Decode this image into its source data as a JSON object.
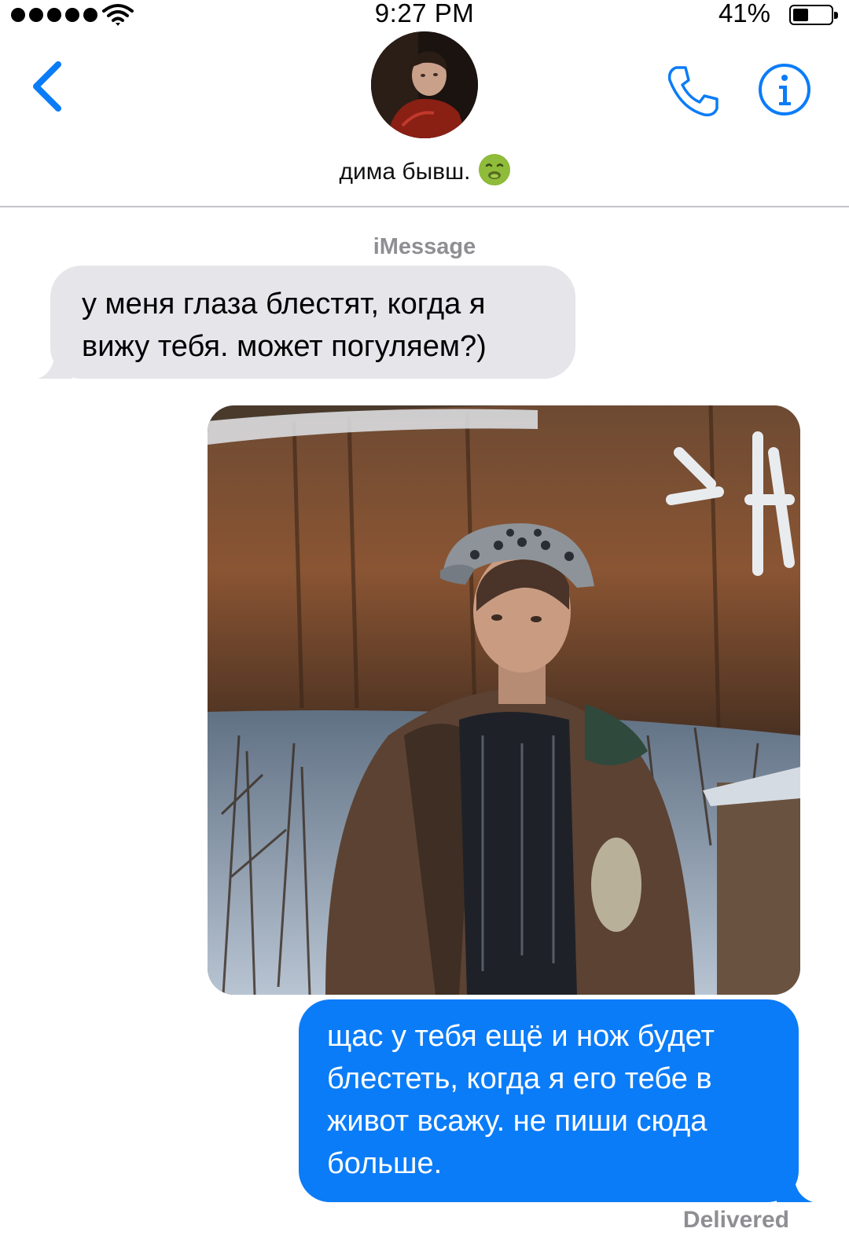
{
  "status_bar": {
    "time": "9:27 PM",
    "battery_percent": "41%",
    "battery_level": 0.41,
    "signal_bars": 5,
    "icons": [
      "signal-dots-icon",
      "wifi-icon",
      "battery-icon"
    ]
  },
  "header": {
    "contact_name": "дима бывш.",
    "contact_emoji": "nauseated-face-emoji",
    "icons": [
      "back-chevron-icon",
      "phone-icon",
      "info-icon"
    ]
  },
  "conversation": {
    "service_label": "iMessage",
    "messages": [
      {
        "direction": "incoming",
        "type": "text",
        "text": "у меня глаза блестят, когда я вижу тебя. может погуляем?)"
      },
      {
        "direction": "outgoing",
        "type": "image"
      },
      {
        "direction": "outgoing",
        "type": "text",
        "text": "щас у тебя ещё и нож будет блестеть, когда я его тебе в живот всажу. не пиши сюда больше."
      }
    ],
    "delivery_status": "Delivered"
  },
  "colors": {
    "accent": "#0b7cf8",
    "incoming_bubble": "#e5e5ea",
    "secondary_text": "#8e8e93"
  }
}
